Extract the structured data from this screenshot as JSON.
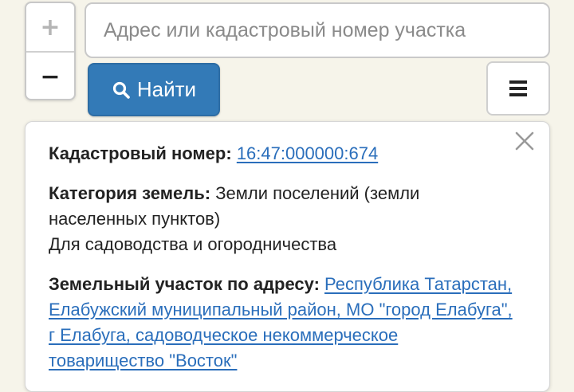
{
  "zoom": {
    "zoom_in": "+",
    "zoom_out": "−"
  },
  "search": {
    "placeholder": "Адрес или кадастровый номер участка",
    "value": ""
  },
  "find_button": {
    "label": "Найти",
    "icon": "search-icon"
  },
  "menu_button": {
    "icon": "hamburger-menu-icon"
  },
  "popup": {
    "close_icon": "close-icon",
    "cadastral_label": "Кадастровый номер:",
    "cadastral_number": "16:47:000000:674",
    "category_label": "Категория земель:",
    "category_value": "Земли поселений (земли населенных пунктов)",
    "permitted_use": "Для садоводства и огородничества",
    "address_label": "Земельный участок по адресу:",
    "address_value": "Республика Татарстан, Елабужский муниципальный район, МО \"город Елабуга\", г Елабуга, садоводческое некоммерческое товарищество \"Восток\""
  },
  "colors": {
    "accent": "#337ab7",
    "link": "#2a6ebb",
    "background": "#f6f4ea"
  }
}
